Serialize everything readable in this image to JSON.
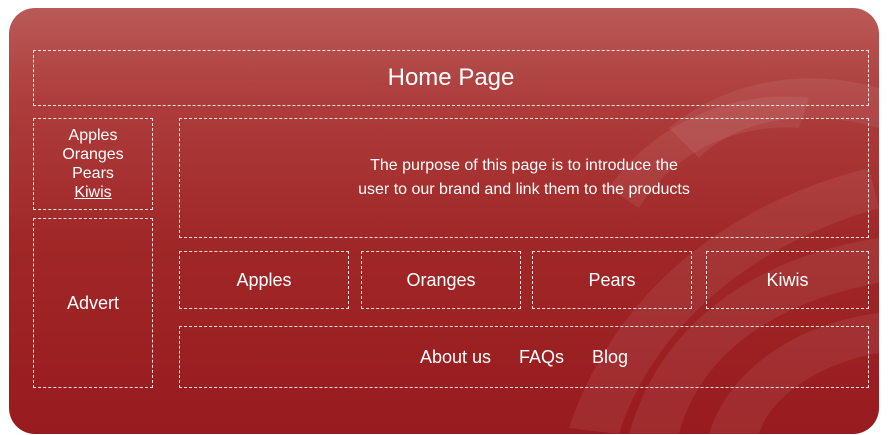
{
  "header": {
    "title": "Home Page"
  },
  "sidebar": {
    "items": [
      "Apples",
      "Oranges",
      "Pears",
      "Kiwis"
    ],
    "advert_label": "Advert"
  },
  "intro": {
    "text": "The purpose of this page is to introduce the\nuser to our brand and link them to the products"
  },
  "products": [
    "Apples",
    "Oranges",
    "Pears",
    "Kiwis"
  ],
  "footer": {
    "links": [
      "About us",
      "FAQs",
      "Blog"
    ]
  },
  "colors": {
    "panel_top": "#b95a57",
    "panel_bottom": "#981b1f",
    "text": "#ffffff"
  }
}
